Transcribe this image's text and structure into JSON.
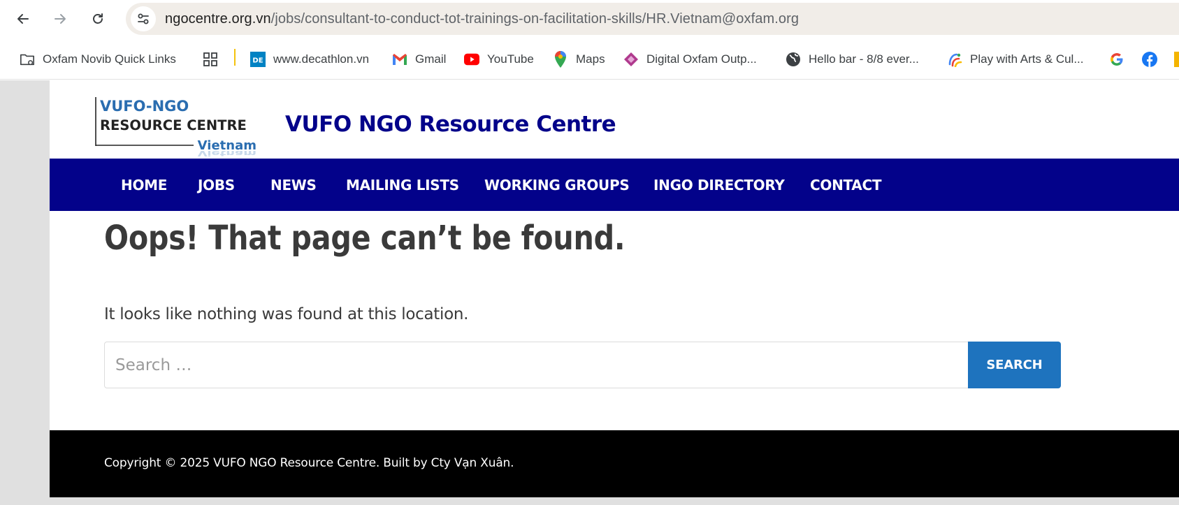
{
  "browser": {
    "url_host": "ngocentre.org.vn",
    "url_path": "/jobs/consultant-to-conduct-tot-trainings-on-facilitation-skills/HR.Vietnam@oxfam.org",
    "bookmarks": [
      {
        "label": "Oxfam Novib Quick Links",
        "icon": "folder-icon"
      },
      {
        "label": "",
        "icon": "apps-grid-icon"
      },
      {
        "label": "www.decathlon.vn",
        "icon": "decathlon-icon"
      },
      {
        "label": "Gmail",
        "icon": "gmail-icon"
      },
      {
        "label": "YouTube",
        "icon": "youtube-icon"
      },
      {
        "label": "Maps",
        "icon": "maps-icon"
      },
      {
        "label": "Digital Oxfam Outp...",
        "icon": "power-apps-icon"
      },
      {
        "label": "Hello bar - 8/8 ever...",
        "icon": "globe-icon"
      },
      {
        "label": "Play with Arts & Cul...",
        "icon": "arts-culture-icon"
      },
      {
        "label": "",
        "icon": "google-icon"
      },
      {
        "label": "",
        "icon": "facebook-icon"
      }
    ]
  },
  "site": {
    "logo": {
      "line1": "VUFO-NGO",
      "line2": "RESOURCE CENTRE",
      "line3": "Vietnam"
    },
    "title": "VUFO NGO Resource Centre",
    "nav": [
      "HOME",
      "JOBS",
      "NEWS",
      "MAILING LISTS",
      "WORKING GROUPS",
      "INGO DIRECTORY",
      "CONTACT"
    ]
  },
  "main": {
    "heading": "Oops! That page can’t be found.",
    "notice": "It looks like nothing was found at this location.",
    "search": {
      "placeholder": "Search …",
      "button": "SEARCH"
    }
  },
  "footer": {
    "copyright": "Copyright © 2025 VUFO NGO Resource Centre. Built by Cty Vạn Xuân."
  },
  "colors": {
    "nav_bg": "#03028a",
    "title": "#03028a",
    "search_button": "#1e73be",
    "footer_bg": "#000000"
  }
}
